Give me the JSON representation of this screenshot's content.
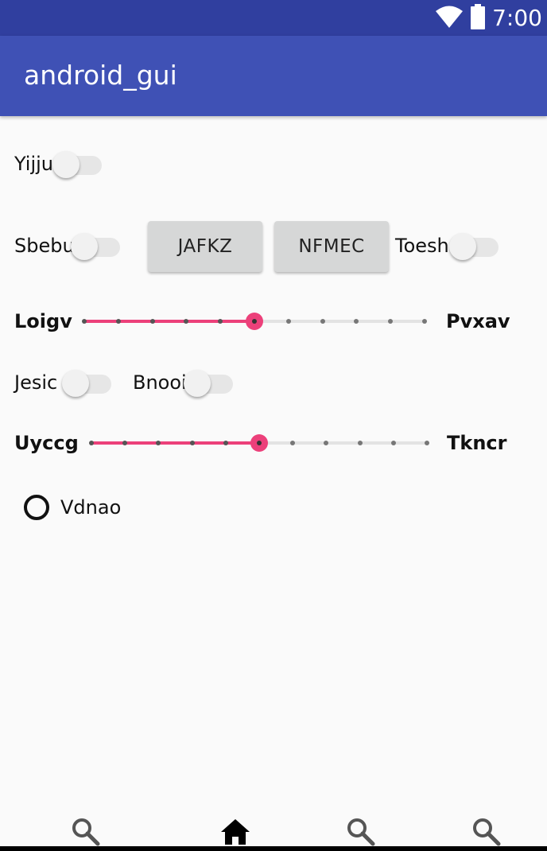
{
  "status_bar": {
    "time": "7:00",
    "icons": [
      "wifi-icon",
      "battery-icon"
    ]
  },
  "app_bar": {
    "title": "android_gui"
  },
  "switches": [
    {
      "label": "Yijju",
      "checked": false
    },
    {
      "label": "Sbebu",
      "checked": false
    },
    {
      "label": "Toesh",
      "checked": false
    },
    {
      "label": "Jesic",
      "checked": false
    },
    {
      "label": "Bnooi",
      "checked": false
    }
  ],
  "buttons": {
    "jafkz": "JAFKZ",
    "nfmec": "NFMEC"
  },
  "sliders": [
    {
      "left_label": "Loigv",
      "right_label": "Pvxav",
      "min": 0,
      "max": 10,
      "value": 5
    },
    {
      "left_label": "Uyccg",
      "right_label": "Tkncr",
      "min": 0,
      "max": 10,
      "value": 5
    }
  ],
  "radio": {
    "label": "Vdnao",
    "checked": false
  },
  "bottom_nav": [
    "search-icon",
    "home-icon",
    "search-icon",
    "search-icon"
  ],
  "colors": {
    "status_bar": "#303f9f",
    "app_bar": "#3f51b5",
    "accent": "#ec407a",
    "background": "#fafafa"
  }
}
